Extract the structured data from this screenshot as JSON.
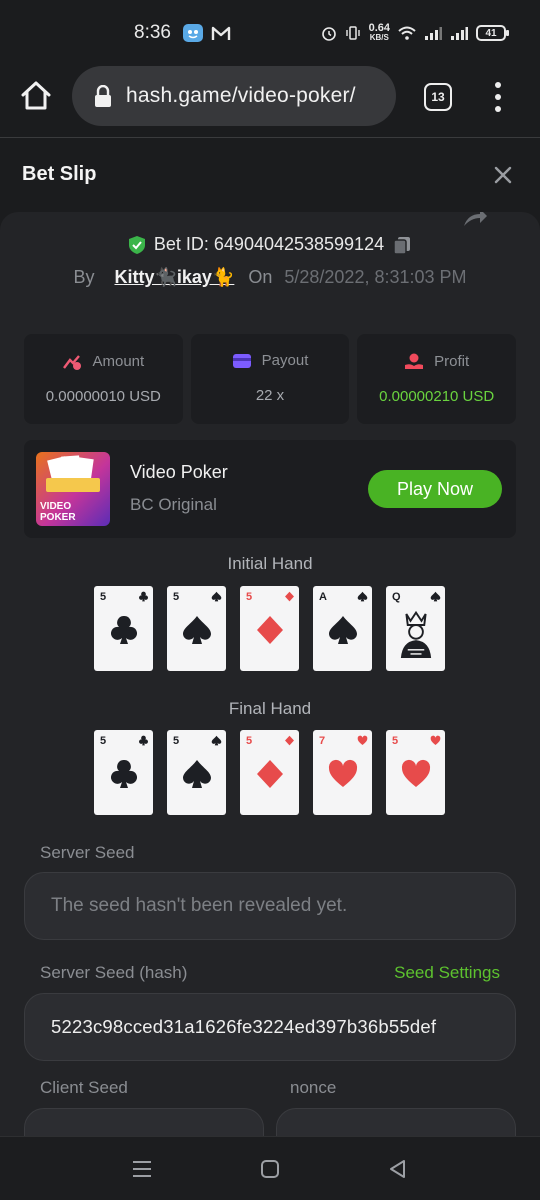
{
  "status_bar": {
    "time": "8:36",
    "net_speed": "0.64",
    "net_unit": "KB/S",
    "battery": "41"
  },
  "browser": {
    "url": "hash.game/video-poker/",
    "tab_count": "13"
  },
  "header": {
    "title": "Bet Slip"
  },
  "bet": {
    "id_label": "Bet ID: 64904042538599124",
    "by_label": "By",
    "user": "Kitty🐈‍⬛ikay🐈",
    "on_label": "On",
    "date": "5/28/2022, 8:31:03 PM"
  },
  "stats": [
    {
      "label": "Amount",
      "value": "0.00000010 USD"
    },
    {
      "label": "Payout",
      "value": "22 x"
    },
    {
      "label": "Profit",
      "value": "0.00000210 USD"
    }
  ],
  "game": {
    "name": "Video Poker",
    "provider": "BC Original",
    "thumb_text_1": "VIDEO",
    "thumb_text_2": "POKER",
    "play_label": "Play Now"
  },
  "initial_hand": {
    "title": "Initial Hand",
    "cards": [
      {
        "rank": "5",
        "suit": "clubs"
      },
      {
        "rank": "5",
        "suit": "spades"
      },
      {
        "rank": "5",
        "suit": "diamonds"
      },
      {
        "rank": "A",
        "suit": "spades"
      },
      {
        "rank": "Q",
        "suit": "spades"
      }
    ]
  },
  "final_hand": {
    "title": "Final Hand",
    "cards": [
      {
        "rank": "5",
        "suit": "clubs"
      },
      {
        "rank": "5",
        "suit": "spades"
      },
      {
        "rank": "5",
        "suit": "diamonds"
      },
      {
        "rank": "7",
        "suit": "hearts"
      },
      {
        "rank": "5",
        "suit": "hearts"
      }
    ]
  },
  "server_seed": {
    "label": "Server Seed",
    "placeholder": "The seed hasn't been revealed yet."
  },
  "server_seed_hash": {
    "label": "Server Seed (hash)",
    "settings_link": "Seed Settings",
    "value": "5223c98cced31a1626fe3224ed397b36b55def"
  },
  "client_seed": {
    "label": "Client Seed"
  },
  "nonce": {
    "label": "nonce"
  },
  "colors": {
    "accent_green": "#49b324",
    "profit_green": "#6ad33f",
    "card_red": "#e74b4b"
  }
}
